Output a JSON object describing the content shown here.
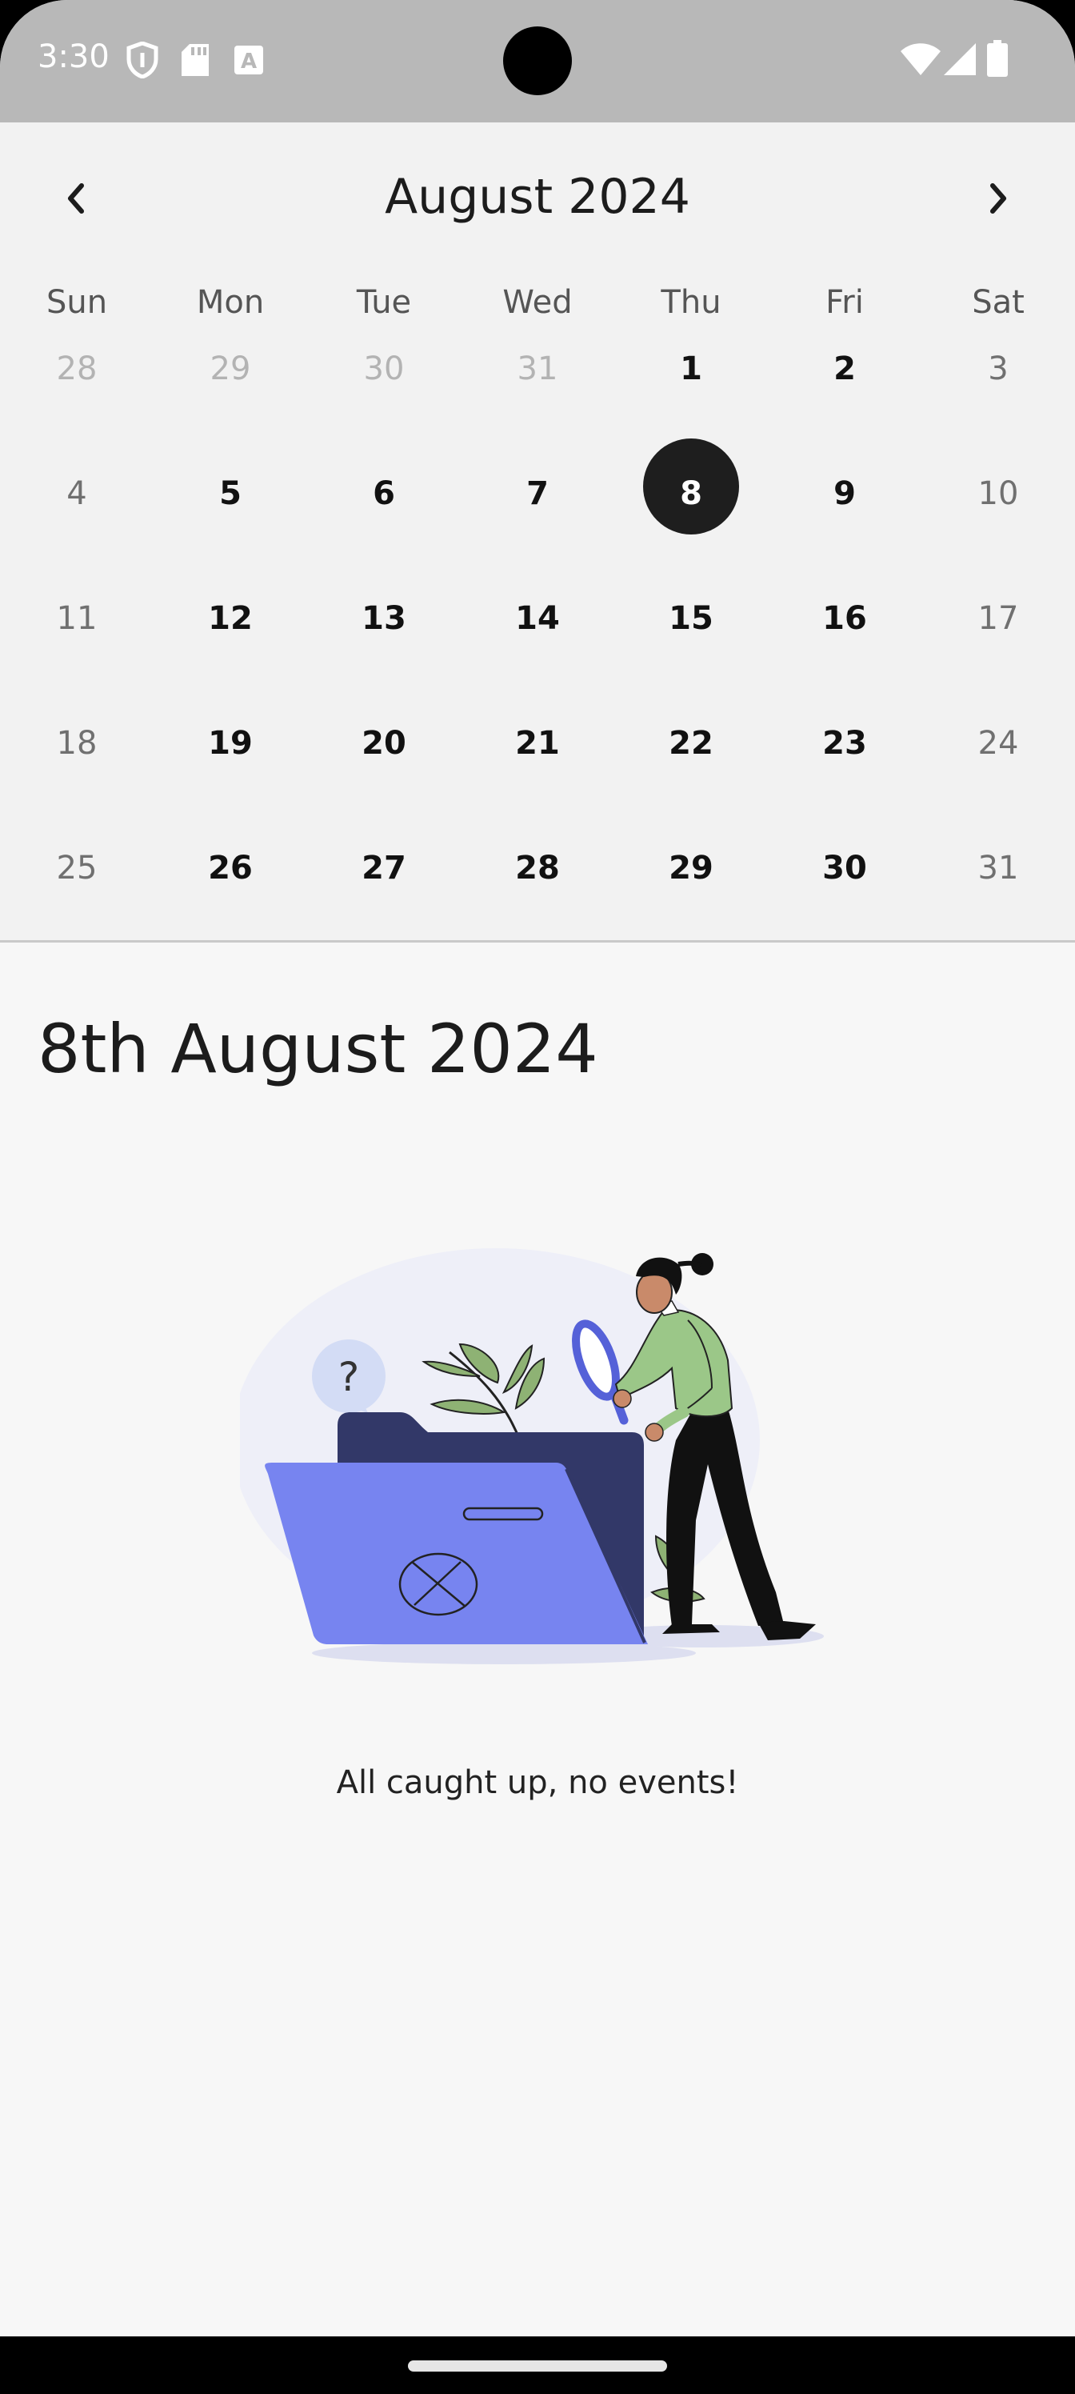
{
  "status_bar": {
    "time": "3:30",
    "left_icons": [
      "shield-icon",
      "sd-card-icon",
      "keyboard-a-icon"
    ],
    "right_icons": [
      "wifi-icon",
      "signal-icon",
      "battery-icon"
    ]
  },
  "calendar": {
    "month_title": "August 2024",
    "prev_icon": "chevron-left-icon",
    "next_icon": "chevron-right-icon",
    "weekdays": [
      "Sun",
      "Mon",
      "Tue",
      "Wed",
      "Thu",
      "Fri",
      "Sat"
    ],
    "weeks": [
      [
        "28",
        "29",
        "30",
        "31",
        "1",
        "2",
        "3"
      ],
      [
        "4",
        "5",
        "6",
        "7",
        "8",
        "9",
        "10"
      ],
      [
        "11",
        "12",
        "13",
        "14",
        "15",
        "16",
        "17"
      ],
      [
        "18",
        "19",
        "20",
        "21",
        "22",
        "23",
        "24"
      ],
      [
        "25",
        "26",
        "27",
        "28",
        "29",
        "30",
        "31"
      ]
    ],
    "selected_day": "8"
  },
  "day_view": {
    "heading": "8th August 2024",
    "empty_message": "All caught up, no events!",
    "illustration_icon": "empty-folder-search-illustration"
  },
  "colors": {
    "status_bar": "#b8b8b8",
    "selected": "#1e1e1e",
    "folder_front": "#7784f0",
    "folder_back": "#323868"
  }
}
